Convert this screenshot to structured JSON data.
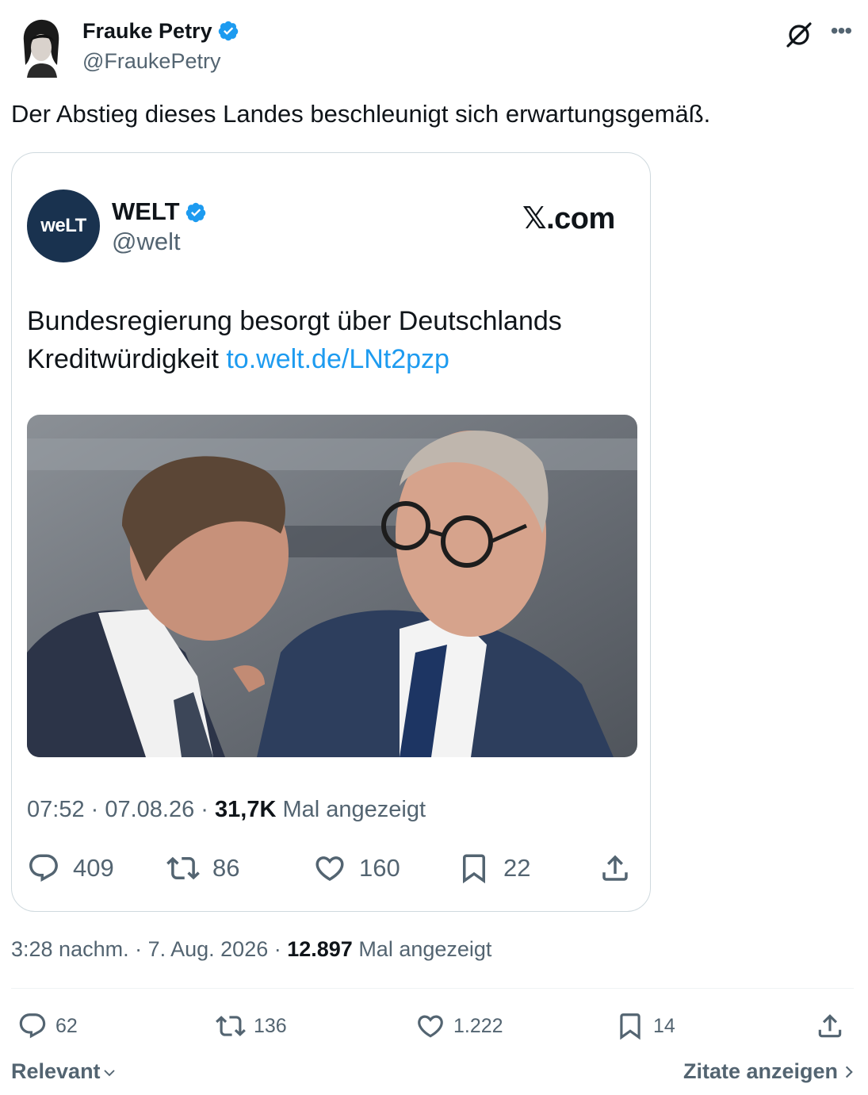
{
  "author": {
    "name": "Frauke Petry",
    "handle": "@FraukePetry"
  },
  "tweet": {
    "text": "Der Abstieg dieses Landes beschleunigt sich erwartungsgemäß."
  },
  "embed": {
    "logo_text": "weLT",
    "name": "WELT",
    "handle": "@welt",
    "site": "𝕏.com",
    "text": "Bundesregierung besorgt über Deutschlands Kreditwürdigkeit ",
    "link": "to.welt.de/LNt2pzp",
    "meta": {
      "time": "07:52 · 07.08.26 · ",
      "views": "31,7K",
      "views_suffix": " Mal angezeigt"
    },
    "stats": {
      "replies": "409",
      "reposts": "86",
      "likes": "160",
      "bookmarks": "22"
    }
  },
  "meta": {
    "time": "3:28 nachm. · 7. Aug. 2026 · ",
    "views": "12.897",
    "views_suffix": " Mal angezeigt"
  },
  "stats": {
    "replies": "62",
    "reposts": "136",
    "likes": "1.222",
    "bookmarks": "14"
  },
  "footer": {
    "sort_label": "Relevant",
    "quotes_label": "Zitate anzeigen"
  },
  "colors": {
    "accent": "#1d9bf0",
    "muted": "#536471",
    "text": "#0f1419",
    "welt_navy": "#19324f"
  }
}
